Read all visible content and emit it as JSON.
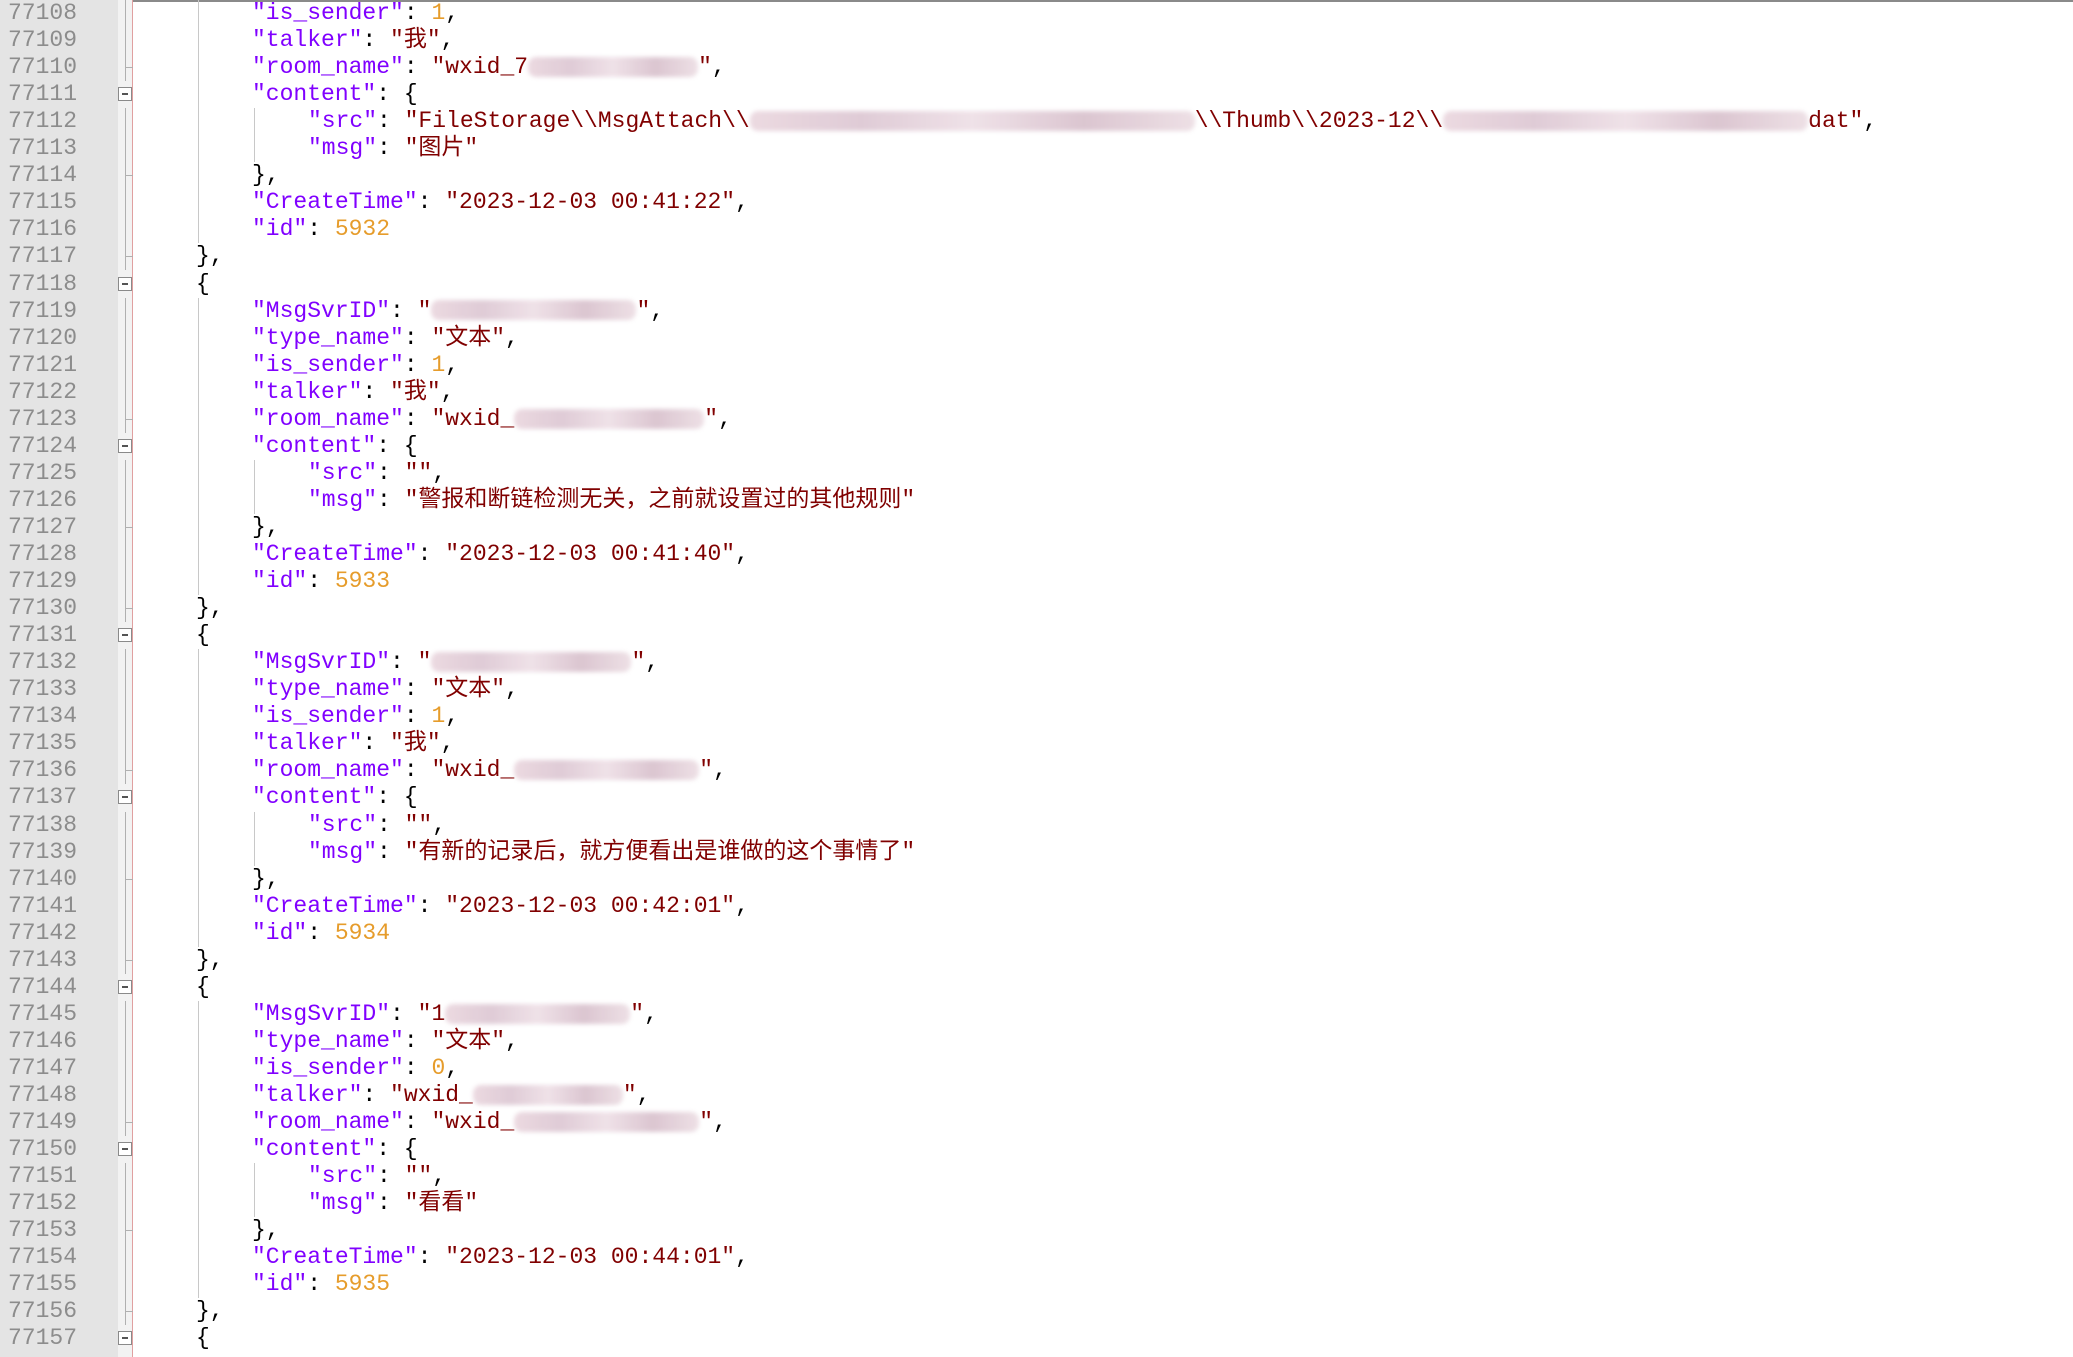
{
  "editor": {
    "lines": [
      {
        "num": "77108",
        "indent": 2,
        "tokens": [
          {
            "t": "k",
            "v": "\"is_sender\""
          },
          {
            "t": "p",
            "v": ": "
          },
          {
            "t": "n",
            "v": "1"
          },
          {
            "t": "p",
            "v": ","
          }
        ]
      },
      {
        "num": "77109",
        "indent": 2,
        "tokens": [
          {
            "t": "k",
            "v": "\"talker\""
          },
          {
            "t": "p",
            "v": ": "
          },
          {
            "t": "s",
            "v": "\"我\""
          },
          {
            "t": "p",
            "v": ","
          }
        ]
      },
      {
        "num": "77110",
        "indent": 2,
        "tokens": [
          {
            "t": "k",
            "v": "\"room_name\""
          },
          {
            "t": "p",
            "v": ": "
          },
          {
            "t": "s",
            "v": "\"wxid_7"
          },
          {
            "t": "blur",
            "v": "170"
          },
          {
            "t": "s",
            "v": "\""
          },
          {
            "t": "p",
            "v": ","
          }
        ]
      },
      {
        "num": "77111",
        "indent": 2,
        "fold": true,
        "tokens": [
          {
            "t": "k",
            "v": "\"content\""
          },
          {
            "t": "p",
            "v": ": {"
          }
        ]
      },
      {
        "num": "77112",
        "indent": 3,
        "tokens": [
          {
            "t": "k",
            "v": "\"src\""
          },
          {
            "t": "p",
            "v": ": "
          },
          {
            "t": "s",
            "v": "\"FileStorage\\\\MsgAttach\\\\"
          },
          {
            "t": "blur",
            "v": "445"
          },
          {
            "t": "s",
            "v": "\\\\Thumb\\\\2023-12\\\\"
          },
          {
            "t": "blur",
            "v": "365"
          },
          {
            "t": "s",
            "v": "dat\""
          },
          {
            "t": "p",
            "v": ","
          }
        ]
      },
      {
        "num": "77113",
        "indent": 3,
        "tokens": [
          {
            "t": "k",
            "v": "\"msg\""
          },
          {
            "t": "p",
            "v": ": "
          },
          {
            "t": "s",
            "v": "\"图片\""
          }
        ]
      },
      {
        "num": "77114",
        "indent": 2,
        "tokens": [
          {
            "t": "p",
            "v": "},"
          }
        ]
      },
      {
        "num": "77115",
        "indent": 2,
        "tokens": [
          {
            "t": "k",
            "v": "\"CreateTime\""
          },
          {
            "t": "p",
            "v": ": "
          },
          {
            "t": "s",
            "v": "\"2023-12-03 00:41:22\""
          },
          {
            "t": "p",
            "v": ","
          }
        ]
      },
      {
        "num": "77116",
        "indent": 2,
        "tokens": [
          {
            "t": "k",
            "v": "\"id\""
          },
          {
            "t": "p",
            "v": ": "
          },
          {
            "t": "n",
            "v": "5932"
          }
        ]
      },
      {
        "num": "77117",
        "indent": 1,
        "tokens": [
          {
            "t": "p",
            "v": "},"
          }
        ]
      },
      {
        "num": "77118",
        "indent": 1,
        "fold": true,
        "tokens": [
          {
            "t": "p",
            "v": "{"
          }
        ]
      },
      {
        "num": "77119",
        "indent": 2,
        "tokens": [
          {
            "t": "k",
            "v": "\"MsgSvrID\""
          },
          {
            "t": "p",
            "v": ": "
          },
          {
            "t": "s",
            "v": "\""
          },
          {
            "t": "blur",
            "v": "205"
          },
          {
            "t": "s",
            "v": "\""
          },
          {
            "t": "p",
            "v": ","
          }
        ]
      },
      {
        "num": "77120",
        "indent": 2,
        "tokens": [
          {
            "t": "k",
            "v": "\"type_name\""
          },
          {
            "t": "p",
            "v": ": "
          },
          {
            "t": "s",
            "v": "\"文本\""
          },
          {
            "t": "p",
            "v": ","
          }
        ]
      },
      {
        "num": "77121",
        "indent": 2,
        "tokens": [
          {
            "t": "k",
            "v": "\"is_sender\""
          },
          {
            "t": "p",
            "v": ": "
          },
          {
            "t": "n",
            "v": "1"
          },
          {
            "t": "p",
            "v": ","
          }
        ]
      },
      {
        "num": "77122",
        "indent": 2,
        "tokens": [
          {
            "t": "k",
            "v": "\"talker\""
          },
          {
            "t": "p",
            "v": ": "
          },
          {
            "t": "s",
            "v": "\"我\""
          },
          {
            "t": "p",
            "v": ","
          }
        ]
      },
      {
        "num": "77123",
        "indent": 2,
        "tokens": [
          {
            "t": "k",
            "v": "\"room_name\""
          },
          {
            "t": "p",
            "v": ": "
          },
          {
            "t": "s",
            "v": "\"wxid_"
          },
          {
            "t": "blur",
            "v": "190"
          },
          {
            "t": "s",
            "v": "\""
          },
          {
            "t": "p",
            "v": ","
          }
        ]
      },
      {
        "num": "77124",
        "indent": 2,
        "fold": true,
        "tokens": [
          {
            "t": "k",
            "v": "\"content\""
          },
          {
            "t": "p",
            "v": ": {"
          }
        ]
      },
      {
        "num": "77125",
        "indent": 3,
        "tokens": [
          {
            "t": "k",
            "v": "\"src\""
          },
          {
            "t": "p",
            "v": ": "
          },
          {
            "t": "s",
            "v": "\"\""
          },
          {
            "t": "p",
            "v": ","
          }
        ]
      },
      {
        "num": "77126",
        "indent": 3,
        "tokens": [
          {
            "t": "k",
            "v": "\"msg\""
          },
          {
            "t": "p",
            "v": ": "
          },
          {
            "t": "s",
            "v": "\"警报和断链检测无关，之前就设置过的其他规则\""
          }
        ]
      },
      {
        "num": "77127",
        "indent": 2,
        "tokens": [
          {
            "t": "p",
            "v": "},"
          }
        ]
      },
      {
        "num": "77128",
        "indent": 2,
        "tokens": [
          {
            "t": "k",
            "v": "\"CreateTime\""
          },
          {
            "t": "p",
            "v": ": "
          },
          {
            "t": "s",
            "v": "\"2023-12-03 00:41:40\""
          },
          {
            "t": "p",
            "v": ","
          }
        ]
      },
      {
        "num": "77129",
        "indent": 2,
        "tokens": [
          {
            "t": "k",
            "v": "\"id\""
          },
          {
            "t": "p",
            "v": ": "
          },
          {
            "t": "n",
            "v": "5933"
          }
        ]
      },
      {
        "num": "77130",
        "indent": 1,
        "tokens": [
          {
            "t": "p",
            "v": "},"
          }
        ]
      },
      {
        "num": "77131",
        "indent": 1,
        "fold": true,
        "tokens": [
          {
            "t": "p",
            "v": "{"
          }
        ]
      },
      {
        "num": "77132",
        "indent": 2,
        "tokens": [
          {
            "t": "k",
            "v": "\"MsgSvrID\""
          },
          {
            "t": "p",
            "v": ": "
          },
          {
            "t": "s",
            "v": "\""
          },
          {
            "t": "blur",
            "v": "200"
          },
          {
            "t": "s",
            "v": "\""
          },
          {
            "t": "p",
            "v": ","
          }
        ]
      },
      {
        "num": "77133",
        "indent": 2,
        "tokens": [
          {
            "t": "k",
            "v": "\"type_name\""
          },
          {
            "t": "p",
            "v": ": "
          },
          {
            "t": "s",
            "v": "\"文本\""
          },
          {
            "t": "p",
            "v": ","
          }
        ]
      },
      {
        "num": "77134",
        "indent": 2,
        "tokens": [
          {
            "t": "k",
            "v": "\"is_sender\""
          },
          {
            "t": "p",
            "v": ": "
          },
          {
            "t": "n",
            "v": "1"
          },
          {
            "t": "p",
            "v": ","
          }
        ]
      },
      {
        "num": "77135",
        "indent": 2,
        "tokens": [
          {
            "t": "k",
            "v": "\"talker\""
          },
          {
            "t": "p",
            "v": ": "
          },
          {
            "t": "s",
            "v": "\"我\""
          },
          {
            "t": "p",
            "v": ","
          }
        ]
      },
      {
        "num": "77136",
        "indent": 2,
        "tokens": [
          {
            "t": "k",
            "v": "\"room_name\""
          },
          {
            "t": "p",
            "v": ": "
          },
          {
            "t": "s",
            "v": "\"wxid_"
          },
          {
            "t": "blur",
            "v": "185"
          },
          {
            "t": "s",
            "v": "\""
          },
          {
            "t": "p",
            "v": ","
          }
        ]
      },
      {
        "num": "77137",
        "indent": 2,
        "fold": true,
        "tokens": [
          {
            "t": "k",
            "v": "\"content\""
          },
          {
            "t": "p",
            "v": ": {"
          }
        ]
      },
      {
        "num": "77138",
        "indent": 3,
        "tokens": [
          {
            "t": "k",
            "v": "\"src\""
          },
          {
            "t": "p",
            "v": ": "
          },
          {
            "t": "s",
            "v": "\"\""
          },
          {
            "t": "p",
            "v": ","
          }
        ]
      },
      {
        "num": "77139",
        "indent": 3,
        "tokens": [
          {
            "t": "k",
            "v": "\"msg\""
          },
          {
            "t": "p",
            "v": ": "
          },
          {
            "t": "s",
            "v": "\"有新的记录后，就方便看出是谁做的这个事情了\""
          }
        ]
      },
      {
        "num": "77140",
        "indent": 2,
        "tokens": [
          {
            "t": "p",
            "v": "},"
          }
        ]
      },
      {
        "num": "77141",
        "indent": 2,
        "tokens": [
          {
            "t": "k",
            "v": "\"CreateTime\""
          },
          {
            "t": "p",
            "v": ": "
          },
          {
            "t": "s",
            "v": "\"2023-12-03 00:42:01\""
          },
          {
            "t": "p",
            "v": ","
          }
        ]
      },
      {
        "num": "77142",
        "indent": 2,
        "tokens": [
          {
            "t": "k",
            "v": "\"id\""
          },
          {
            "t": "p",
            "v": ": "
          },
          {
            "t": "n",
            "v": "5934"
          }
        ]
      },
      {
        "num": "77143",
        "indent": 1,
        "tokens": [
          {
            "t": "p",
            "v": "},"
          }
        ]
      },
      {
        "num": "77144",
        "indent": 1,
        "fold": true,
        "tokens": [
          {
            "t": "p",
            "v": "{"
          }
        ]
      },
      {
        "num": "77145",
        "indent": 2,
        "tokens": [
          {
            "t": "k",
            "v": "\"MsgSvrID\""
          },
          {
            "t": "p",
            "v": ": "
          },
          {
            "t": "s",
            "v": "\"1"
          },
          {
            "t": "blur",
            "v": "185"
          },
          {
            "t": "s",
            "v": "\""
          },
          {
            "t": "p",
            "v": ","
          }
        ]
      },
      {
        "num": "77146",
        "indent": 2,
        "tokens": [
          {
            "t": "k",
            "v": "\"type_name\""
          },
          {
            "t": "p",
            "v": ": "
          },
          {
            "t": "s",
            "v": "\"文本\""
          },
          {
            "t": "p",
            "v": ","
          }
        ]
      },
      {
        "num": "77147",
        "indent": 2,
        "tokens": [
          {
            "t": "k",
            "v": "\"is_sender\""
          },
          {
            "t": "p",
            "v": ": "
          },
          {
            "t": "n",
            "v": "0"
          },
          {
            "t": "p",
            "v": ","
          }
        ]
      },
      {
        "num": "77148",
        "indent": 2,
        "tokens": [
          {
            "t": "k",
            "v": "\"talker\""
          },
          {
            "t": "p",
            "v": ": "
          },
          {
            "t": "s",
            "v": "\"wxid_"
          },
          {
            "t": "blur",
            "v": "150"
          },
          {
            "t": "s",
            "v": "\""
          },
          {
            "t": "p",
            "v": ","
          }
        ]
      },
      {
        "num": "77149",
        "indent": 2,
        "tokens": [
          {
            "t": "k",
            "v": "\"room_name\""
          },
          {
            "t": "p",
            "v": ": "
          },
          {
            "t": "s",
            "v": "\"wxid_"
          },
          {
            "t": "blur",
            "v": "185"
          },
          {
            "t": "s",
            "v": "\""
          },
          {
            "t": "p",
            "v": ","
          }
        ]
      },
      {
        "num": "77150",
        "indent": 2,
        "fold": true,
        "tokens": [
          {
            "t": "k",
            "v": "\"content\""
          },
          {
            "t": "p",
            "v": ": {"
          }
        ]
      },
      {
        "num": "77151",
        "indent": 3,
        "tokens": [
          {
            "t": "k",
            "v": "\"src\""
          },
          {
            "t": "p",
            "v": ": "
          },
          {
            "t": "s",
            "v": "\"\""
          },
          {
            "t": "p",
            "v": ","
          }
        ]
      },
      {
        "num": "77152",
        "indent": 3,
        "tokens": [
          {
            "t": "k",
            "v": "\"msg\""
          },
          {
            "t": "p",
            "v": ": "
          },
          {
            "t": "s",
            "v": "\"看看\""
          }
        ]
      },
      {
        "num": "77153",
        "indent": 2,
        "tokens": [
          {
            "t": "p",
            "v": "},"
          }
        ]
      },
      {
        "num": "77154",
        "indent": 2,
        "tokens": [
          {
            "t": "k",
            "v": "\"CreateTime\""
          },
          {
            "t": "p",
            "v": ": "
          },
          {
            "t": "s",
            "v": "\"2023-12-03 00:44:01\""
          },
          {
            "t": "p",
            "v": ","
          }
        ]
      },
      {
        "num": "77155",
        "indent": 2,
        "tokens": [
          {
            "t": "k",
            "v": "\"id\""
          },
          {
            "t": "p",
            "v": ": "
          },
          {
            "t": "n",
            "v": "5935"
          }
        ]
      },
      {
        "num": "77156",
        "indent": 1,
        "tokens": [
          {
            "t": "p",
            "v": "},"
          }
        ]
      },
      {
        "num": "77157",
        "indent": 1,
        "fold": true,
        "tokens": [
          {
            "t": "p",
            "v": "{"
          }
        ]
      }
    ]
  }
}
